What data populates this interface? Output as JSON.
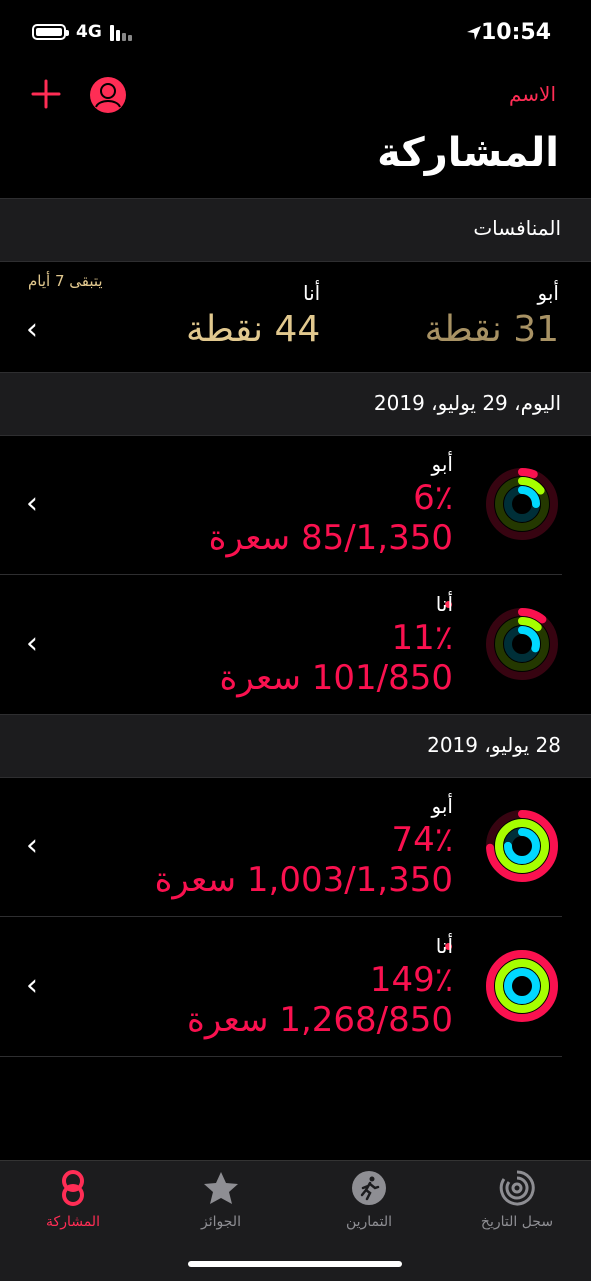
{
  "status": {
    "network": "4G",
    "time": "10:54"
  },
  "header": {
    "name_link": "الاسم",
    "title": "المشاركة"
  },
  "competitions": {
    "section_title": "المنافسات",
    "days_left": "يتبقى 7 أيام",
    "opponent": {
      "name": "أبو",
      "score": "31 نقطة"
    },
    "me": {
      "name": "أنا",
      "score": "44 نقطة"
    }
  },
  "days": [
    {
      "date": "اليوم، 29 يوليو، 2019",
      "rows": [
        {
          "name": "أبو",
          "percent": "6٪",
          "calories": "85/1,350 سعرة",
          "move": 0.06,
          "exercise": 0.15,
          "stand": 0.25
        },
        {
          "name": "أنا",
          "percent": "11٪",
          "calories": "101/850 سعرة",
          "move": 0.11,
          "exercise": 0.12,
          "stand": 0.3
        }
      ]
    },
    {
      "date": "28 يوليو، 2019",
      "rows": [
        {
          "name": "أبو",
          "percent": "74٪",
          "calories": "1,003/1,350 سعرة",
          "move": 0.74,
          "exercise": 1.0,
          "stand": 0.75
        },
        {
          "name": "أنا",
          "percent": "149٪",
          "calories": "1,268/850 سعرة",
          "move": 1.0,
          "exercise": 1.0,
          "stand": 1.0
        }
      ]
    }
  ],
  "tabs": [
    {
      "label": "المشاركة",
      "icon": "sharing-icon",
      "active": true
    },
    {
      "label": "الجوائز",
      "icon": "awards-star-icon",
      "active": false
    },
    {
      "label": "التمارين",
      "icon": "workouts-runner-icon",
      "active": false
    },
    {
      "label": "سجل التاريخ",
      "icon": "history-rings-icon",
      "active": false
    }
  ],
  "colors": {
    "accent": "#ff2d55",
    "gold": "#e1c88e",
    "move": "#fa114f",
    "exercise": "#a6ff00",
    "stand": "#00d8ff"
  }
}
